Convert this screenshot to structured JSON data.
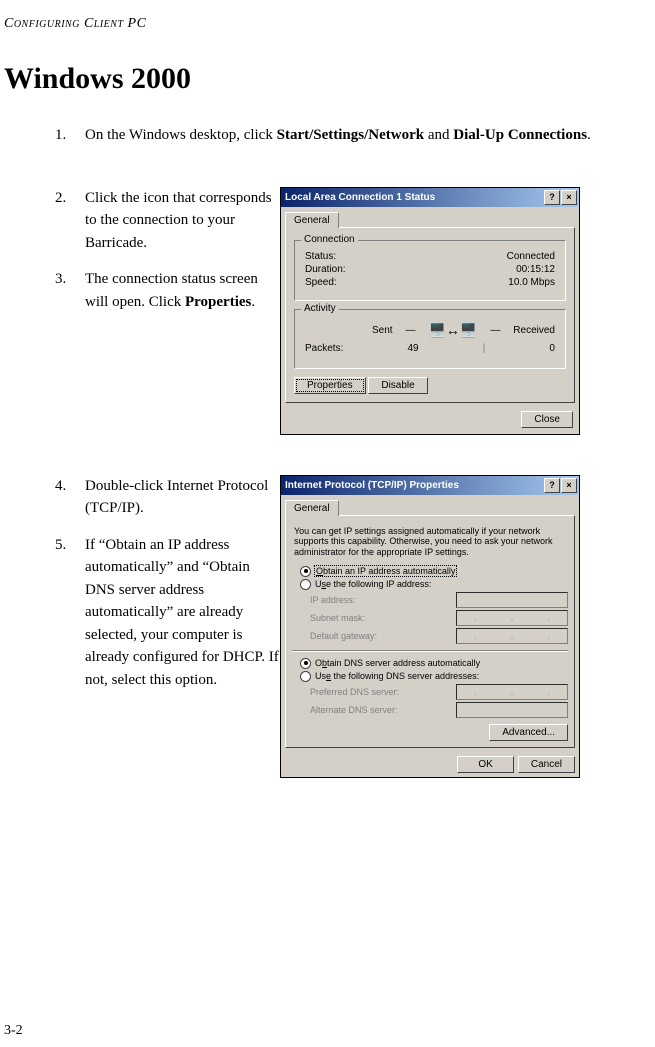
{
  "header": "Configuring Client PC",
  "title": "Windows 2000",
  "steps": {
    "s1": {
      "num": "1.",
      "pre": "On the Windows desktop, click ",
      "bold1": "Start/Settings/Network",
      "mid": " and ",
      "bold2": "Dial-Up Connections",
      "post": "."
    },
    "s2": {
      "num": "2.",
      "text": "Click the icon that corresponds to the connection to your Barricade."
    },
    "s3": {
      "num": "3.",
      "pre": "The connection status screen will open. Click ",
      "bold": "Properties",
      "post": "."
    },
    "s4": {
      "num": "4.",
      "text": "Double-click Internet Protocol (TCP/IP)."
    },
    "s5": {
      "num": "5.",
      "text": "If “Obtain an IP address automatically” and “Obtain DNS server address automatically” are already selected, your computer is already configured for DHCP. If not, select this option."
    }
  },
  "dlg1": {
    "title": "Local Area Connection 1 Status",
    "tab": "General",
    "grp_conn": "Connection",
    "status_l": "Status:",
    "status_v": "Connected",
    "dur_l": "Duration:",
    "dur_v": "00:15:12",
    "speed_l": "Speed:",
    "speed_v": "10.0 Mbps",
    "grp_act": "Activity",
    "sent": "Sent",
    "recv": "Received",
    "pkt_l": "Packets:",
    "pkt_sent": "49",
    "pkt_recv": "0",
    "btn_props": "Properties",
    "btn_disable": "Disable",
    "btn_close": "Close"
  },
  "dlg2": {
    "title": "Internet Protocol (TCP/IP) Properties",
    "tab": "General",
    "desc": "You can get IP settings assigned automatically if your network supports this capability. Otherwise, you need to ask your network administrator for the appropriate IP settings.",
    "r1": "Obtain an IP address automatically",
    "r2": "Use the following IP address:",
    "ip_l": "IP address:",
    "mask_l": "Subnet mask:",
    "gw_l": "Default gateway:",
    "r3": "Obtain DNS server address automatically",
    "r4": "Use the following DNS server addresses:",
    "pdns_l": "Preferred DNS server:",
    "adns_l": "Alternate DNS server:",
    "btn_adv": "Advanced...",
    "btn_ok": "OK",
    "btn_cancel": "Cancel"
  },
  "pagenum": "3-2"
}
